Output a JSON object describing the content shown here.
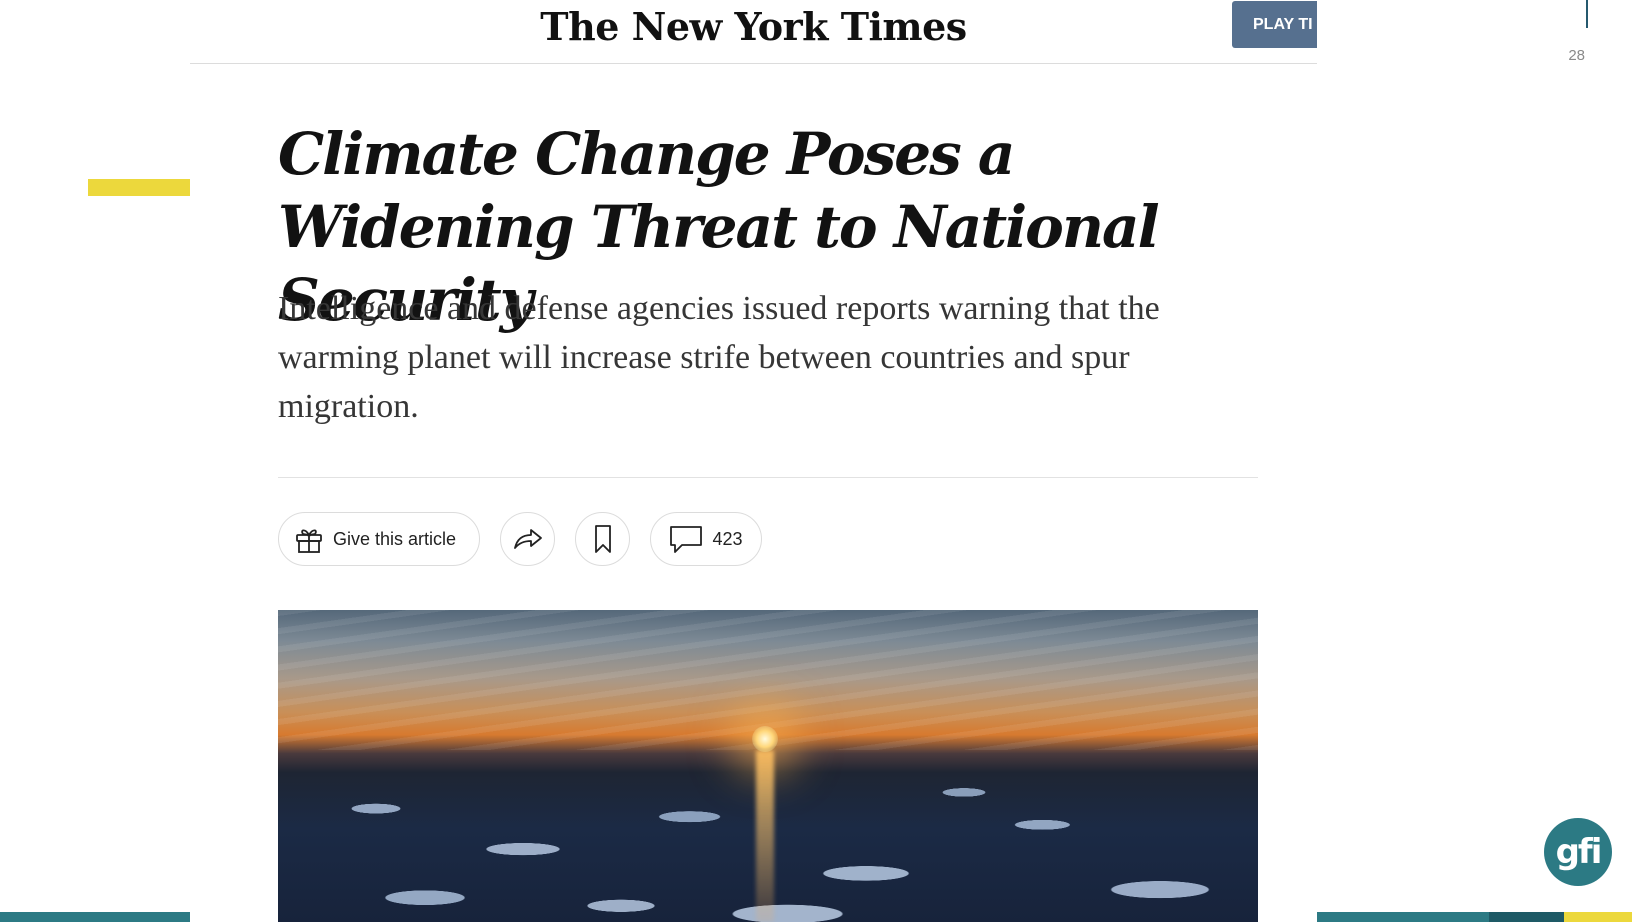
{
  "slide": {
    "page_number": "28",
    "logo_text": "gfi",
    "colors": {
      "teal": "#2c7a84",
      "dark_teal": "#1e5a66",
      "yellow": "#ecd83c"
    }
  },
  "nyt": {
    "masthead": "The New York Times",
    "play_button_label": "PLAY TI",
    "headline": "Climate Change Poses a Widening Threat to National Security",
    "summary": "Intelligence and defense agencies issued reports warning that the warming planet will increase strife between countries and spur migration.",
    "actions": {
      "gift_label": "Give this article",
      "comment_count": "423",
      "icons": [
        "gift-icon",
        "share-icon",
        "bookmark-icon",
        "comment-icon"
      ]
    },
    "lead_image": {
      "subject": "sunset-over-sea-ice-photo"
    },
    "colors": {
      "play_button": "#56708f",
      "headline": "#121212",
      "summary": "#363636"
    }
  }
}
